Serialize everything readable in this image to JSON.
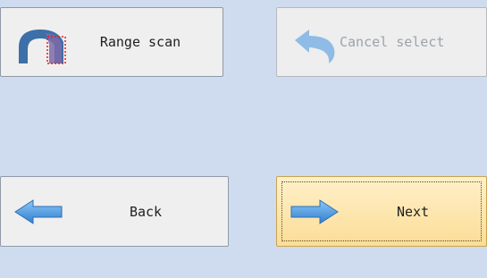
{
  "buttons": {
    "range_scan": {
      "label": "Range scan",
      "icon": "range-scan-icon"
    },
    "cancel_select": {
      "label": "Cancel select",
      "icon": "undo-arrow-icon",
      "enabled": false
    },
    "back": {
      "label": "Back",
      "icon": "arrow-left-icon"
    },
    "next": {
      "label": "Next",
      "icon": "arrow-right-icon",
      "default": true
    }
  },
  "colors": {
    "background": "#cfdcef",
    "button_face": "#efefef",
    "default_button": "#fbe0a0",
    "arrow_blue": "#4a9be3"
  }
}
